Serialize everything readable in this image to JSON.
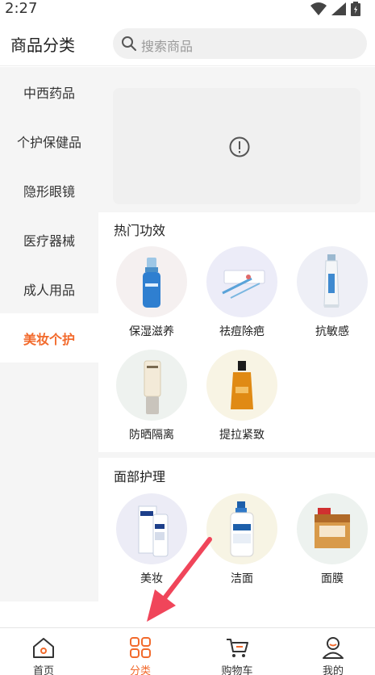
{
  "status_bar": {
    "time": "2:27"
  },
  "header": {
    "title": "商品分类",
    "search_placeholder": "搜索商品"
  },
  "sidebar": {
    "items": [
      {
        "label": "中西药品",
        "active": false
      },
      {
        "label": "个护保健品",
        "active": false
      },
      {
        "label": "隐形眼镜",
        "active": false
      },
      {
        "label": "医疗器械",
        "active": false
      },
      {
        "label": "成人用品",
        "active": false
      },
      {
        "label": "美妆个护",
        "active": true
      }
    ]
  },
  "hot_section": {
    "title": "热门功效",
    "items": [
      {
        "label": "保湿滋养",
        "icon": "blue-serum-bottle-icon",
        "bg": "#f6f0f0"
      },
      {
        "label": "祛痘除疤",
        "icon": "acne-treatment-kit-icon",
        "bg": "#eeeef8"
      },
      {
        "label": "抗敏感",
        "icon": "cream-tube-icon",
        "bg": "#eef0f6"
      },
      {
        "label": "防晒隔离",
        "icon": "sunscreen-bottle-icon",
        "bg": "#eef3f0"
      },
      {
        "label": "提拉紧致",
        "icon": "oil-bottle-icon",
        "bg": "#f8f4e6"
      }
    ]
  },
  "face_section": {
    "title": "面部护理",
    "items": [
      {
        "label": "美妆",
        "icon": "cerave-bottles-icon",
        "bg": "#eeeef8"
      },
      {
        "label": "洁面",
        "icon": "cetaphil-bottle-icon",
        "bg": "#f7f4e6"
      },
      {
        "label": "面膜",
        "icon": "face-mask-box-icon",
        "bg": "#eef3f0"
      }
    ]
  },
  "bottom_nav": {
    "items": [
      {
        "label": "首页",
        "icon": "home-icon",
        "active": false
      },
      {
        "label": "分类",
        "icon": "category-grid-icon",
        "active": true
      },
      {
        "label": "购物车",
        "icon": "cart-icon",
        "active": false
      },
      {
        "label": "我的",
        "icon": "profile-icon",
        "active": false
      }
    ]
  },
  "colors": {
    "accent": "#f26a2c",
    "annotation_arrow": "#f0455a"
  }
}
